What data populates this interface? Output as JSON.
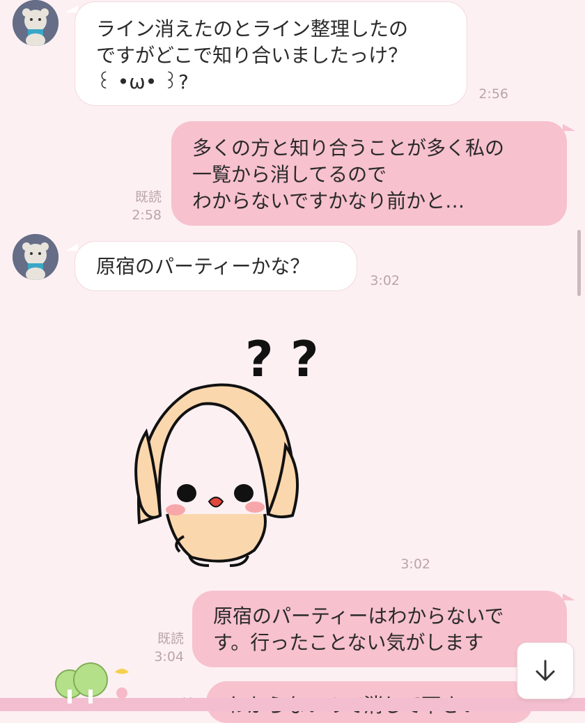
{
  "messages": [
    {
      "type": "received",
      "text": "ライン消えたのとライン整理したの\nですがどこで知り合いましたっけ？\n꒰ •ω• ꒱?",
      "time": "2:56"
    },
    {
      "type": "sent",
      "text": "多くの方と知り合うことが多く私の\n一覧から消してるので\nわからないですかなり前かと…",
      "read": "既読",
      "time": "2:58"
    },
    {
      "type": "received",
      "text": "原宿のパーティーかな？",
      "time": "3:02"
    },
    {
      "type": "sticker",
      "marks": "? ?",
      "time": "3:02"
    },
    {
      "type": "sent",
      "text": "原宿のパーティーはわからないで\nす。行ったことない気がします",
      "read": "既読",
      "time": "3:04"
    },
    {
      "type": "sent",
      "text": "わからないので消して下さい",
      "read": "既読",
      "time": ""
    }
  ],
  "icons": {
    "avatar": "teddy-bear-avatar",
    "scroll_down": "arrow-down-icon"
  },
  "colors": {
    "background": "#fdf0f3",
    "sent_bubble": "#f7c1ce",
    "received_bubble": "#ffffff",
    "meta_text": "#b9a4ab"
  }
}
